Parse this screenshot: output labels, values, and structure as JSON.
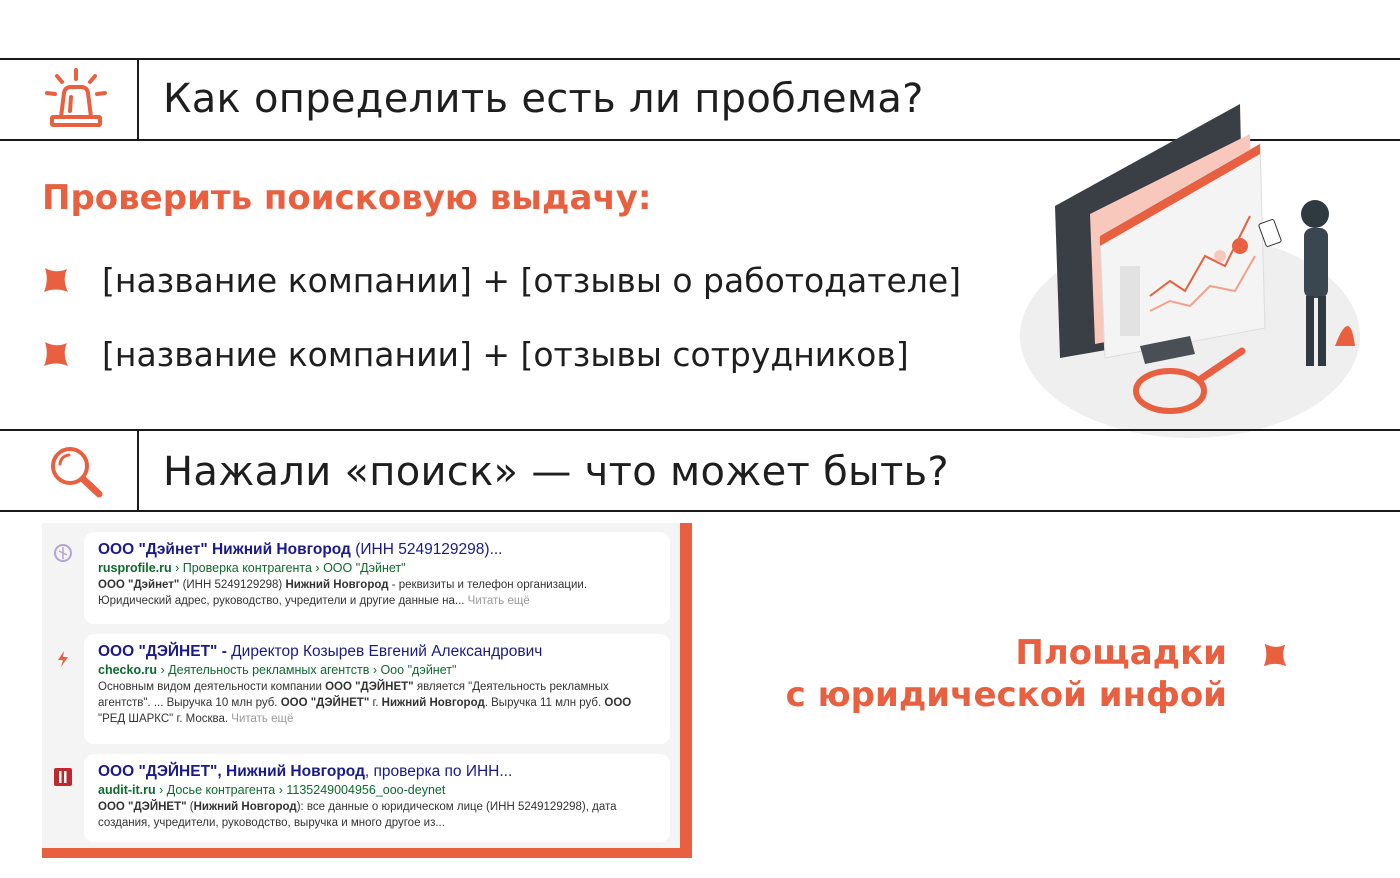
{
  "section1": {
    "title": "Как определить есть ли проблема?",
    "icon": "siren-icon"
  },
  "check": {
    "heading": "Проверить поисковую выдачу:",
    "bullets": [
      "[название компании] + [отзывы о работодателе]",
      "[название компании] + [отзывы сотрудников]"
    ]
  },
  "section2": {
    "title": "Нажали «поиск»  — что может быть?",
    "icon": "search-icon"
  },
  "results": [
    {
      "icon": "rusprofile-favicon",
      "title_a": "ООО \"Дэйнет\" Нижний Новгород",
      "title_b": " (ИНН 5249129298)...",
      "domain": "rusprofile.ru",
      "path": " › Проверка контрагента › ООО \"Дэйнет\"",
      "snippet_1a": "ООО \"Дэйнет\"",
      "snippet_1b": " (ИНН 5249129298) ",
      "snippet_1c": "Нижний Новгород",
      "snippet_1d": " - реквизиты и телефон организации.",
      "snippet_2": "Юридический адрес, руководство, учредители и другие данные на... ",
      "more": "Читать ещё"
    },
    {
      "icon": "checko-favicon",
      "title_a": "ООО \"ДЭЙНЕТ\" - ",
      "title_b": "Директор Козырев Евгений Александрович",
      "domain": "checko.ru",
      "path": " › Деятельность рекламных агентств › Ооо \"дэйнет\"",
      "snippet_1a": "Основным видом деятельности компании ",
      "snippet_1b": "ООО \"ДЭЙНЕТ\"",
      "snippet_1c": " является \"Деятельность рекламных",
      "snippet_2a": "агентств\". ... Выручка 10 млн руб. ",
      "snippet_2b": "ООО \"ДЭЙНЕТ\"",
      "snippet_2c": " г. ",
      "snippet_2d": "Нижний Новгород",
      "snippet_2e": ". Выручка 11 млн руб. ",
      "snippet_2f": "ООО",
      "snippet_3": "\"РЕД ШАРКС\" г. Москва. ",
      "more": "Читать ещё"
    },
    {
      "icon": "audit-it-favicon",
      "title_a": "ООО \"ДЭЙНЕТ\", Нижний Новгород",
      "title_b": ", проверка по ИНН...",
      "domain": "audit-it.ru",
      "path": " › Досье контрагента › 1135249004956_ooo-deynet",
      "snippet_1a": "ООО \"ДЭЙНЕТ\"",
      "snippet_1b": " (",
      "snippet_1c": "Нижний Новгород",
      "snippet_1d": "): все данные о юридическом лице (ИНН 5249129298), дата",
      "snippet_2": "создания, учредители, руководство, выручка и много другое из..."
    }
  ],
  "callout": {
    "line1": "Площадки",
    "line2": "с юридической инфой"
  },
  "colors": {
    "accent": "#e8603f",
    "title_link": "#1a1a8c",
    "url": "#0b6b2d"
  }
}
